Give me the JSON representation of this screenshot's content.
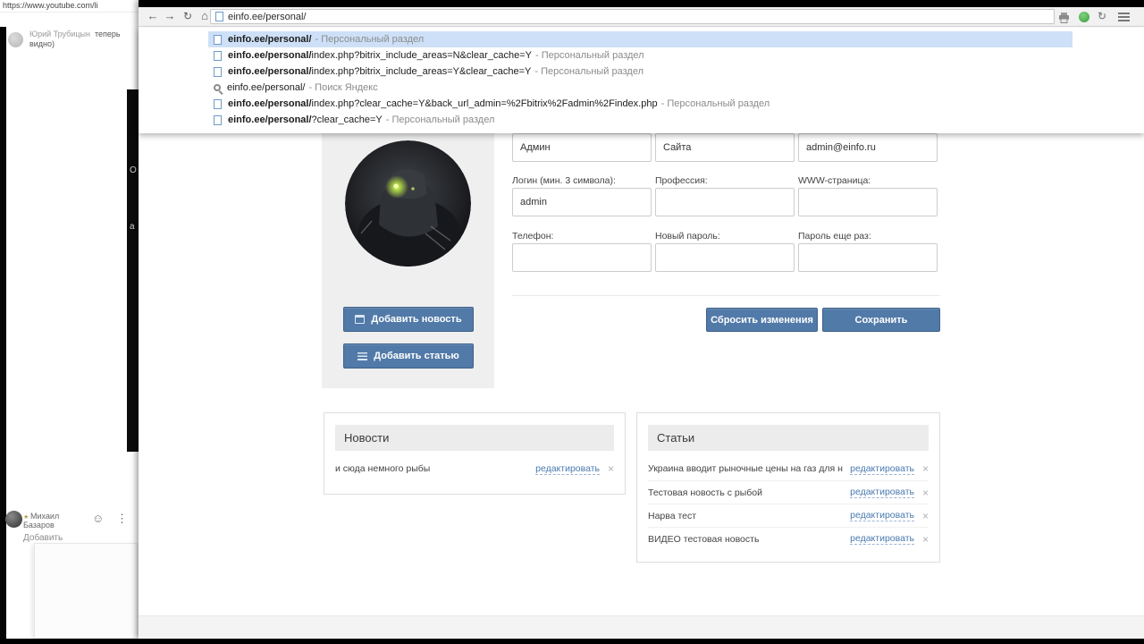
{
  "ui": {
    "close": "×"
  },
  "left_window": {
    "url": "https://www.youtube.com/li",
    "edge_letters": [
      "О",
      "а"
    ],
    "chat_top": {
      "author": "Юрий Трубицын",
      "message": "теперь видно)"
    },
    "chat_bottom": {
      "badge": "★",
      "name_line1": "Михаил",
      "name_line2": "Базаров",
      "action": "Добавить",
      "emoji_icon": "☺",
      "menu_icon": "⋮"
    }
  },
  "browser": {
    "toolbar": {
      "back_icon": "←",
      "forward_icon": "→",
      "reload_icon": "↻",
      "home_icon": "⌂",
      "sync_icon": "↻",
      "url": "einfo.ee/personal/"
    },
    "suggestions": [
      {
        "icon": "page",
        "url_bold": "einfo.ee/personal/",
        "url_rest": "",
        "desc": "- Персональный раздел",
        "selected": true
      },
      {
        "icon": "page",
        "url_bold": "einfo.ee/personal/",
        "url_rest": "index.php?bitrix_include_areas=N&clear_cache=Y",
        "desc": "- Персональный раздел"
      },
      {
        "icon": "page",
        "url_bold": "einfo.ee/personal/",
        "url_rest": "index.php?bitrix_include_areas=Y&clear_cache=Y",
        "desc": "- Персональный раздел"
      },
      {
        "icon": "search",
        "url_bold": "",
        "url_rest": "einfo.ee/personal/",
        "desc": "- Поиск Яндекс"
      },
      {
        "icon": "page",
        "url_bold": "einfo.ee/personal/",
        "url_rest": "index.php?clear_cache=Y&back_url_admin=%2Fbitrix%2Fadmin%2Findex.php",
        "desc": "- Персональный раздел",
        "teal": true
      },
      {
        "icon": "page",
        "url_bold": "einfo.ee/personal/",
        "url_rest": "?clear_cache=Y",
        "desc": "- Персональный раздел"
      }
    ]
  },
  "profile": {
    "actions": [
      {
        "icon": "calendar",
        "label": "Добавить новость"
      },
      {
        "icon": "list",
        "label": "Добавить статью"
      }
    ],
    "form_row1": [
      {
        "value": "Админ"
      },
      {
        "value": "Сайта"
      },
      {
        "value": "admin@einfo.ru"
      }
    ],
    "form_row2": [
      {
        "label": "Логин (мин. 3 символа):",
        "value": "admin"
      },
      {
        "label": "Профессия:",
        "value": ""
      },
      {
        "label": "WWW-страница:",
        "value": ""
      }
    ],
    "form_row3": [
      {
        "label": "Телефон:",
        "value": ""
      },
      {
        "label": "Новый пароль:",
        "value": ""
      },
      {
        "label": "Пароль еще раз:",
        "value": ""
      }
    ],
    "reset_label": "Сбросить изменения",
    "save_label": "Сохранить"
  },
  "news": {
    "title": "Новости",
    "edit_label": "редактировать",
    "items": [
      {
        "text": "и сюда немного рыбы"
      }
    ]
  },
  "articles": {
    "title": "Статьи",
    "edit_label": "редактировать",
    "items": [
      {
        "text": "Украина вводит рыночные цены на газ для населения"
      },
      {
        "text": "Тестовая новость с рыбой"
      },
      {
        "text": "Нарва тест"
      },
      {
        "text": "ВИДЕО тестовая новость"
      }
    ]
  }
}
